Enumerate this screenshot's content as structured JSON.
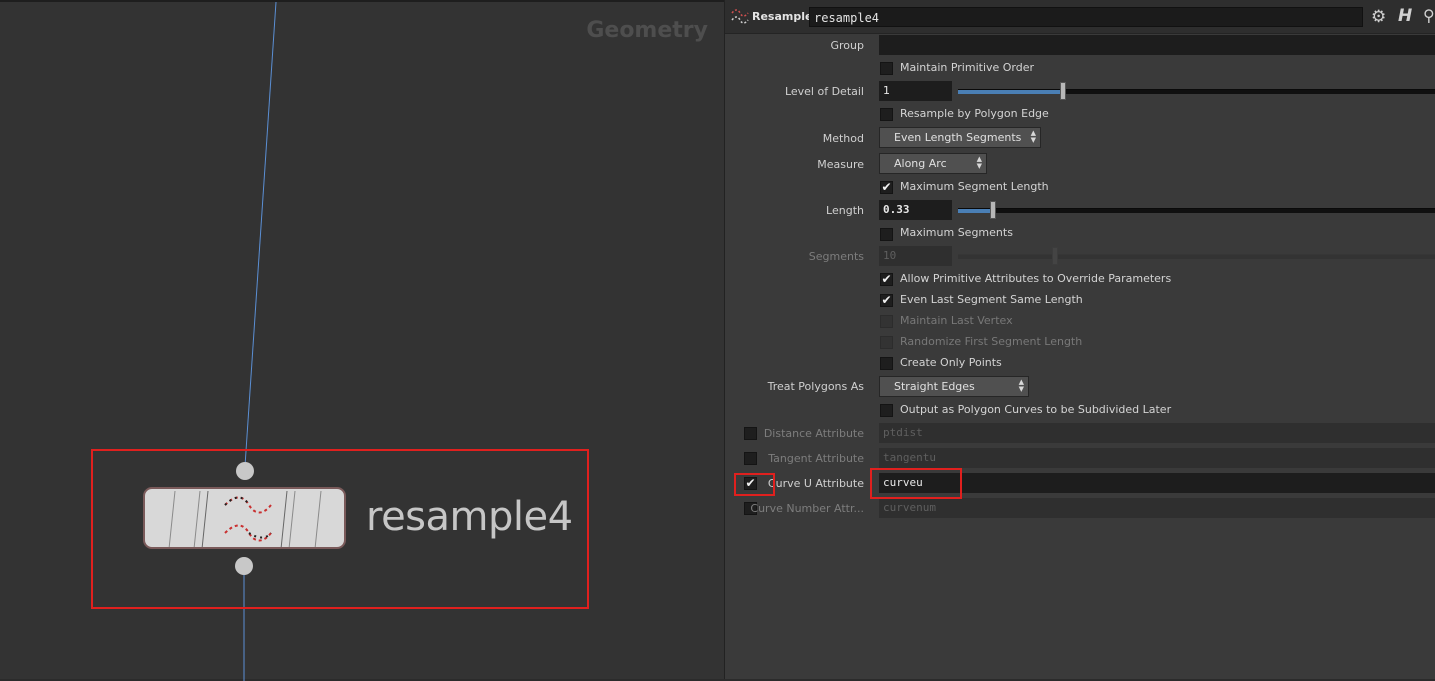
{
  "network": {
    "context_label": "Geometry",
    "node": {
      "name": "resample4",
      "type_icon": "resample-curve-icon"
    }
  },
  "parm": {
    "node_type": "Resample",
    "node_name": "resample4",
    "toolbar_icons": [
      "gear-icon",
      "houdini-help-icon",
      "search-icon"
    ],
    "group": {
      "label": "Group",
      "value": ""
    },
    "maintain_primitive_order": {
      "label": "Maintain Primitive Order",
      "checked": false
    },
    "level_of_detail": {
      "label": "Level of Detail",
      "value": "1",
      "slider_fraction": 0.2
    },
    "resample_by_polygon_edge": {
      "label": "Resample by Polygon Edge",
      "checked": false
    },
    "method": {
      "label": "Method",
      "value": "Even Length Segments"
    },
    "measure": {
      "label": "Measure",
      "value": "Along Arc"
    },
    "maximum_segment_length": {
      "label": "Maximum Segment Length",
      "checked": true
    },
    "length": {
      "label": "Length",
      "value": "0.33",
      "slider_fraction": 0.07
    },
    "maximum_segments": {
      "label": "Maximum Segments",
      "checked": false
    },
    "segments": {
      "label": "Segments",
      "value": "10",
      "enabled": false
    },
    "allow_prim_attribs": {
      "label": "Allow Primitive Attributes to Override Parameters",
      "checked": true
    },
    "even_last_segment": {
      "label": "Even Last Segment Same Length",
      "checked": true
    },
    "maintain_last_vertex": {
      "label": "Maintain Last Vertex",
      "checked": false,
      "enabled": false
    },
    "randomize_first_segment": {
      "label": "Randomize First Segment Length",
      "checked": false,
      "enabled": false
    },
    "create_only_points": {
      "label": "Create Only Points",
      "checked": false
    },
    "treat_polygons_as": {
      "label": "Treat Polygons As",
      "value": "Straight Edges"
    },
    "output_polygon_curves": {
      "label": "Output as Polygon Curves to be Subdivided Later",
      "checked": false
    },
    "distance_attribute": {
      "label": "Distance Attribute",
      "value": "ptdist",
      "checked": false
    },
    "tangent_attribute": {
      "label": "Tangent Attribute",
      "value": "tangentu",
      "checked": false
    },
    "curve_u_attribute": {
      "label": "Curve U Attribute",
      "value": "curveu",
      "checked": true
    },
    "curve_number_attribute": {
      "label": "Curve Number Attr...",
      "value": "curvenum",
      "checked": false
    }
  },
  "colors": {
    "highlight": "#e0201e",
    "wire": "#5b8fd4",
    "slider_fill": "#4a7fb5"
  }
}
